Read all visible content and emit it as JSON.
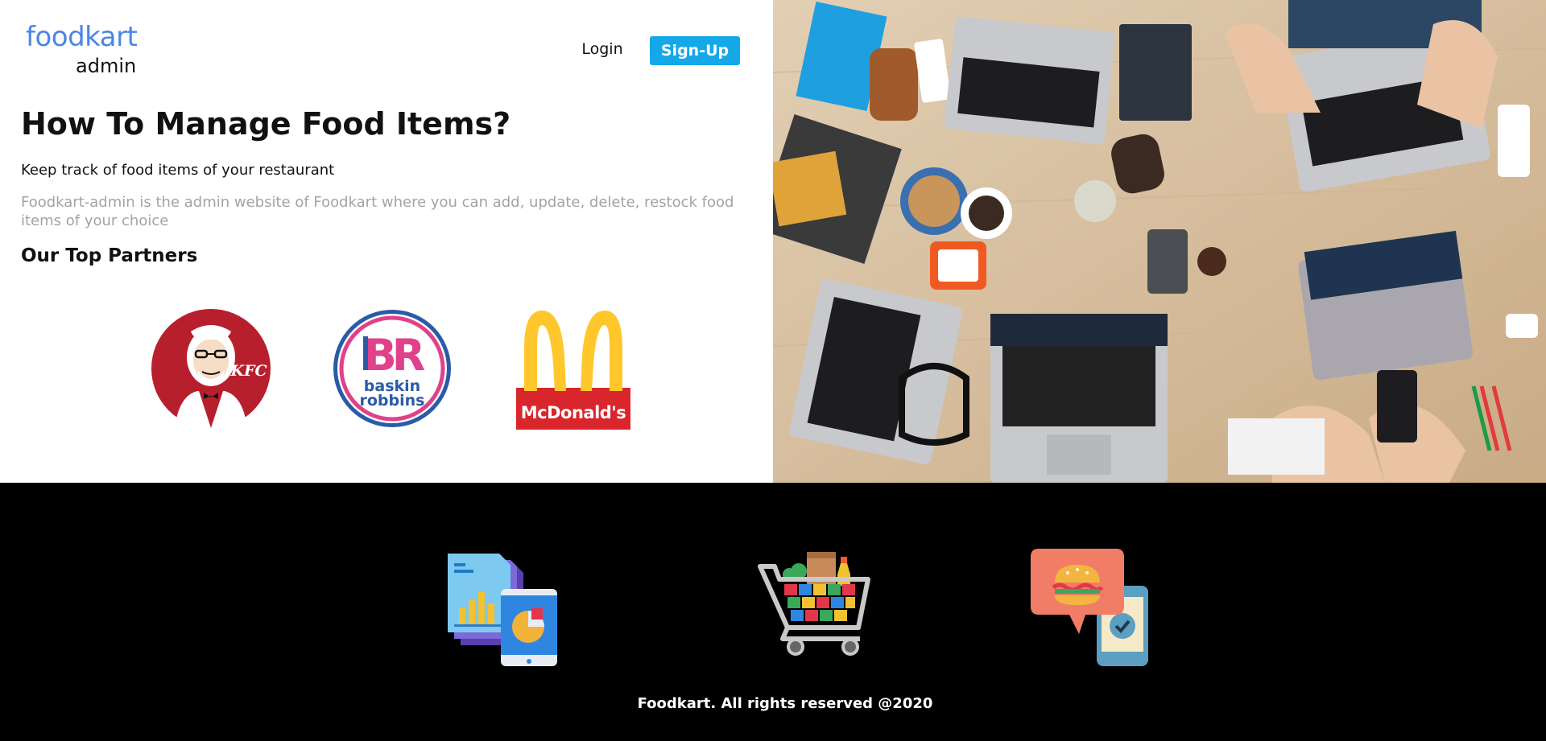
{
  "brand": {
    "name": "foodkart",
    "subtitle": "admin"
  },
  "nav": {
    "login_label": "Login",
    "signup_label": "Sign-Up"
  },
  "hero": {
    "title": "How To Manage Food Items?",
    "subtitle": "Keep track of food items of your restaurant",
    "description": "Foodkart-admin is the admin website of Foodkart where you can add, update, delete, restock food items of your choice"
  },
  "partners": {
    "heading": "Our Top Partners",
    "logos": [
      {
        "name": "KFC",
        "icon": "kfc-logo"
      },
      {
        "name": "Baskin Robbins",
        "icon": "baskin-robbins-logo",
        "line1": "baskin",
        "line2": "robbins"
      },
      {
        "name": "McDonald's",
        "icon": "mcdonalds-logo",
        "text": "McDonald's"
      }
    ]
  },
  "features": [
    {
      "icon": "report-mobile-icon"
    },
    {
      "icon": "shopping-cart-icon"
    },
    {
      "icon": "food-order-chat-icon"
    }
  ],
  "footer": {
    "copyright": "Foodkart. All rights reserved @2020"
  },
  "colors": {
    "brand_blue": "#4a86e8",
    "signup_bg": "#14a8e8",
    "footer_bg": "#000000",
    "muted_text": "#a3a3a3"
  }
}
